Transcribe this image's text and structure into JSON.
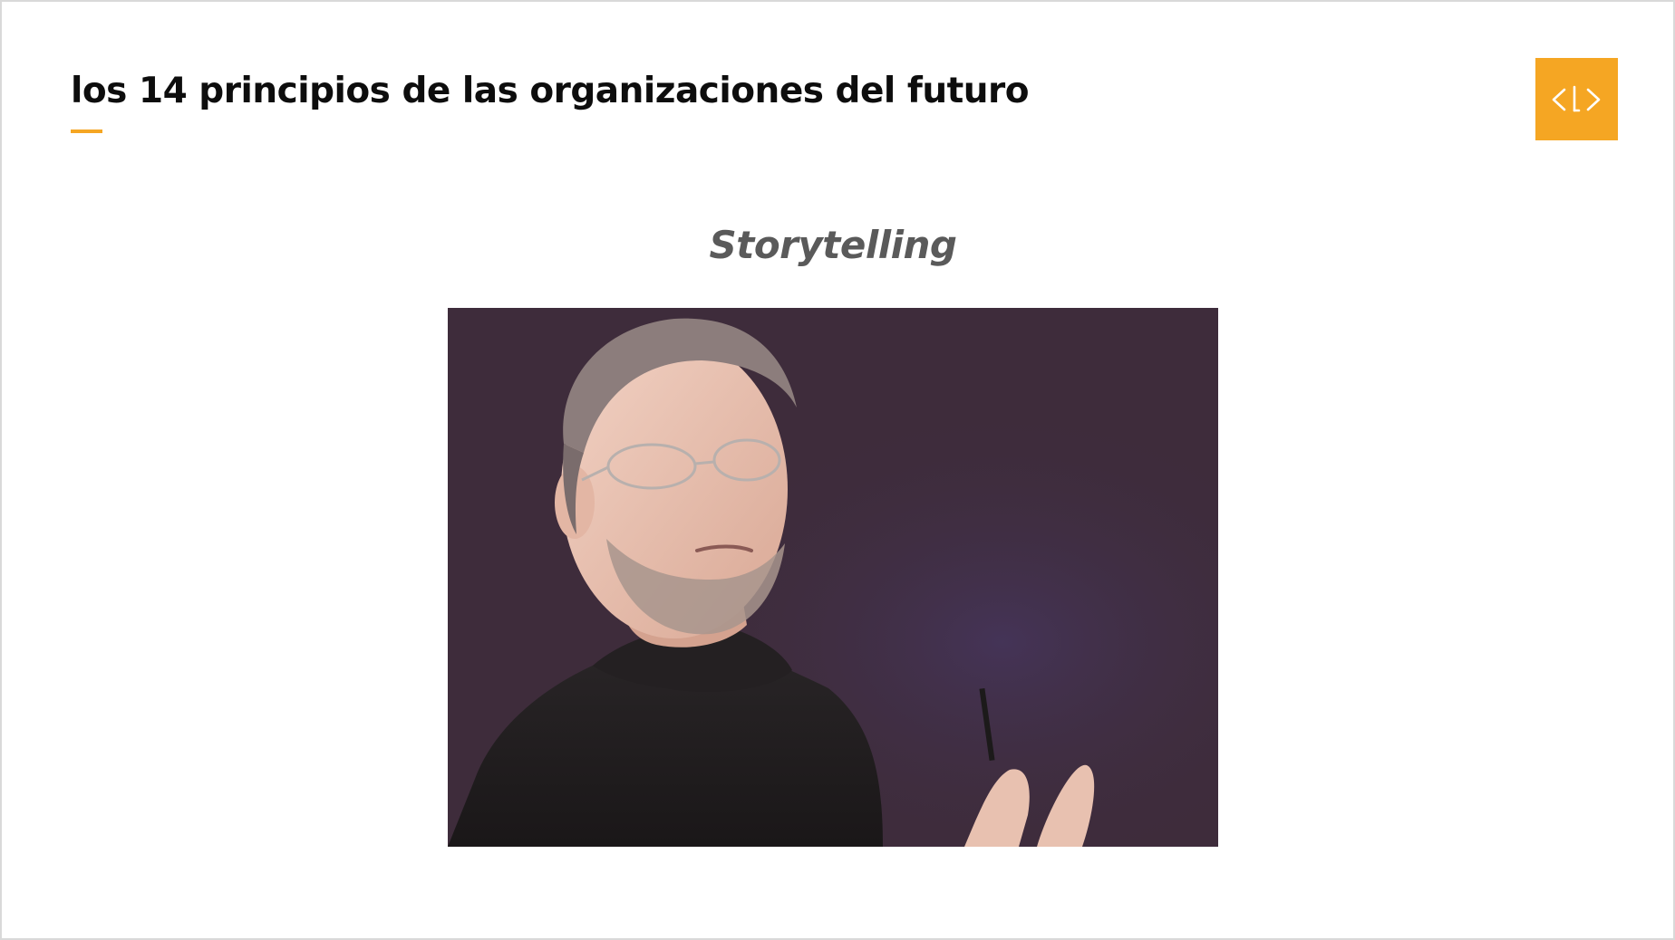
{
  "slide": {
    "title": "los 14 principios de las organizaciones del futuro",
    "subtitle": "Storytelling",
    "colors": {
      "accent": "#f5a623",
      "photo_background": "#3e2c3b"
    },
    "logo_icon": "code-brackets-icon",
    "photo": "presenter-portrait"
  }
}
